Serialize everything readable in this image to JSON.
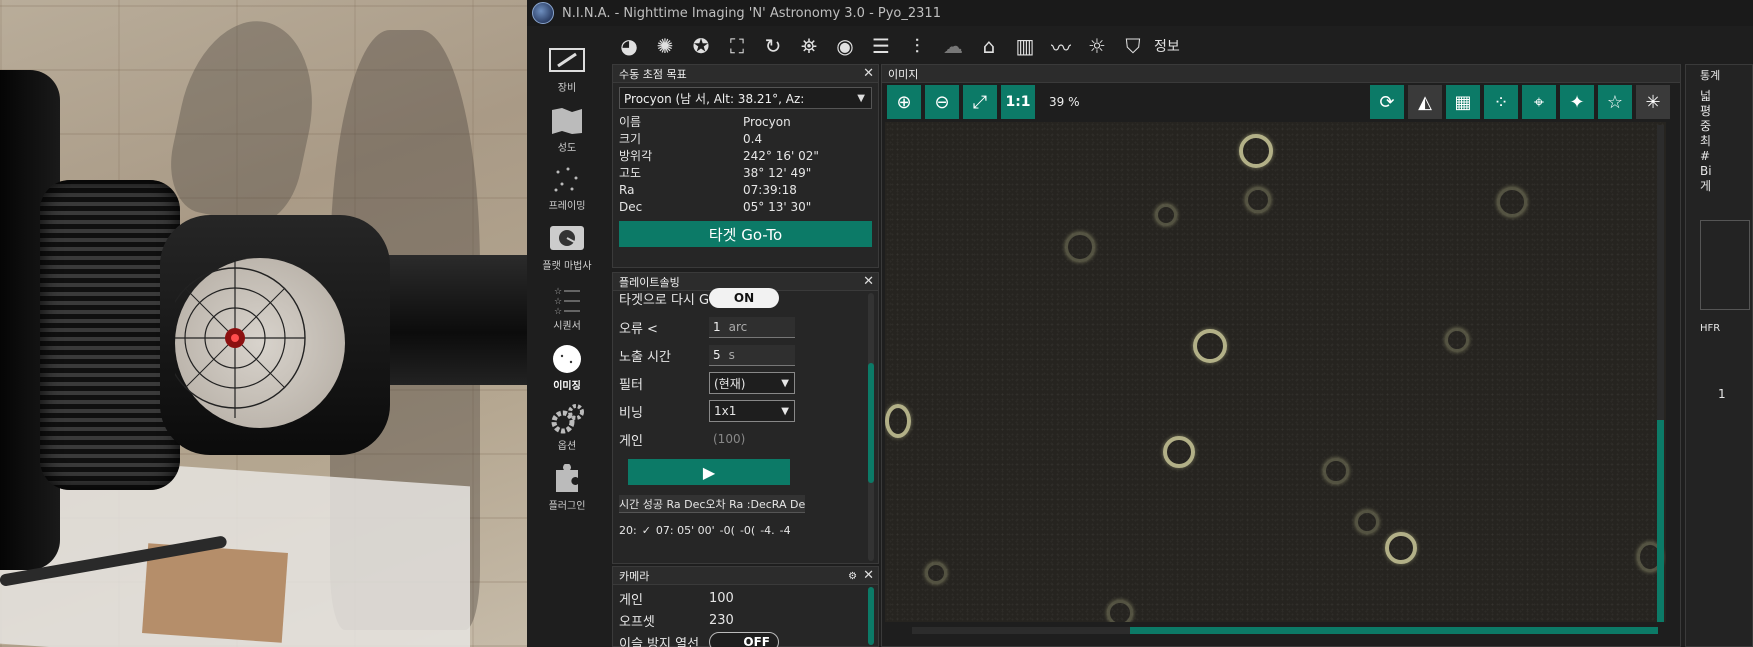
{
  "window": {
    "title": "N.I.N.A. - Nighttime Imaging 'N' Astronomy 3.0   -  Pyo_2311"
  },
  "nav": {
    "items": [
      {
        "label": "장비"
      },
      {
        "label": "성도"
      },
      {
        "label": "프레이밍"
      },
      {
        "label": "플랫 마법사"
      },
      {
        "label": "시퀀서"
      },
      {
        "label": "이미징"
      },
      {
        "label": "옵션"
      },
      {
        "label": "플러그인"
      }
    ],
    "active": "이미징"
  },
  "toolbar": {
    "info_label": "정보"
  },
  "manual_target": {
    "header": "수동 초점 목표",
    "selected": "Procyon (남 서, Alt: 38.21°, Az:",
    "rows": [
      {
        "k": "이름",
        "v": "Procyon"
      },
      {
        "k": "크기",
        "v": "0.4"
      },
      {
        "k": "방위각",
        "v": "242° 16' 02\""
      },
      {
        "k": "고도",
        "v": "38° 12' 49\""
      },
      {
        "k": "Ra",
        "v": "07:39:18"
      },
      {
        "k": "Dec",
        "v": "05° 13' 30\""
      }
    ],
    "goto_label": "타겟 Go-To"
  },
  "plate_solving": {
    "header": "플레이트솔빙",
    "reslew_label": "타겟으로 다시 G",
    "reslew_toggle": "ON",
    "error_label": "오류 <",
    "error_value": "1",
    "error_unit": "arc",
    "exposure_label": "노출 시간",
    "exposure_value": "5",
    "exposure_unit": "s",
    "filter_label": "필터",
    "filter_value": "(현재)",
    "binning_label": "비닝",
    "binning_value": "1x1",
    "gain_label": "게인",
    "gain_value": "(100)",
    "table_header": "시간 성공 Ra Dec오차 Ra :DecRA De",
    "table_row": [
      "20:",
      "07: 05' 00'",
      "-0(",
      "-0(",
      "-4.",
      "-4"
    ]
  },
  "camera": {
    "header": "카메라",
    "gain_label": "게인",
    "gain_value": "100",
    "offset_label": "오프셋",
    "offset_value": "230",
    "dew_label": "이슬 방지 열선",
    "dew_toggle": "OFF"
  },
  "image_panel": {
    "header": "이미지",
    "one_to_one": "1:1",
    "zoom": "39 %"
  },
  "right_panel": {
    "header": "통계",
    "lines": [
      "넓",
      "평",
      "중",
      "최",
      "#",
      "Bi",
      "게"
    ],
    "hfr_label": "HFR",
    "hfr_value": "1"
  },
  "colors": {
    "accent": "#0c7a67",
    "background": "#1e1e1e",
    "panel": "#262626"
  }
}
